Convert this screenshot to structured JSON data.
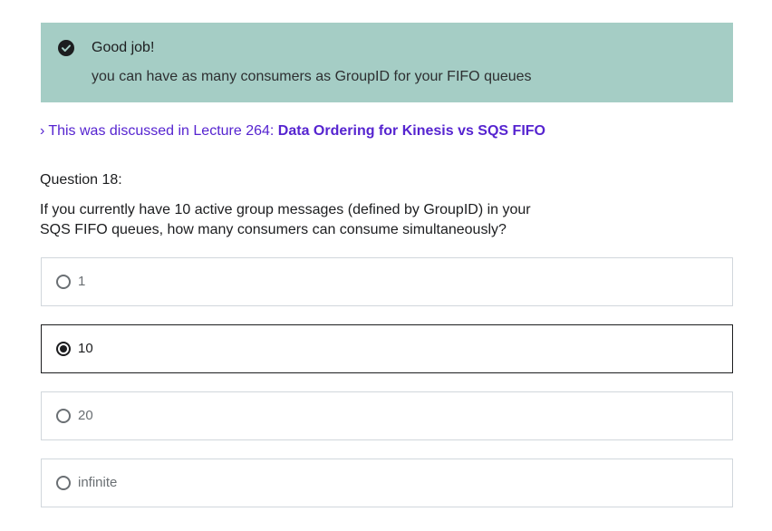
{
  "feedback": {
    "icon": "check-circle-icon",
    "title": "Good job!",
    "message": "you can have as many consumers as GroupID for your FIFO queues"
  },
  "lecture_ref": {
    "icon": "chevron-right-icon",
    "prefix": "This was discussed in Lecture 264: ",
    "title": "Data Ordering for Kinesis vs SQS FIFO"
  },
  "question": {
    "number_label": "Question 18:",
    "text": "If you currently have 10 active group messages (defined by GroupID) in your SQS FIFO queues, how many consumers can consume simultaneously?",
    "options": [
      {
        "label": "1",
        "selected": false
      },
      {
        "label": "10",
        "selected": true
      },
      {
        "label": "20",
        "selected": false
      },
      {
        "label": "infinite",
        "selected": false
      }
    ]
  },
  "colors": {
    "feedback_bg": "#a5cdc5",
    "link": "#5624d0",
    "selected_border": "#1c1d1f",
    "option_border": "#d1d7dc"
  }
}
